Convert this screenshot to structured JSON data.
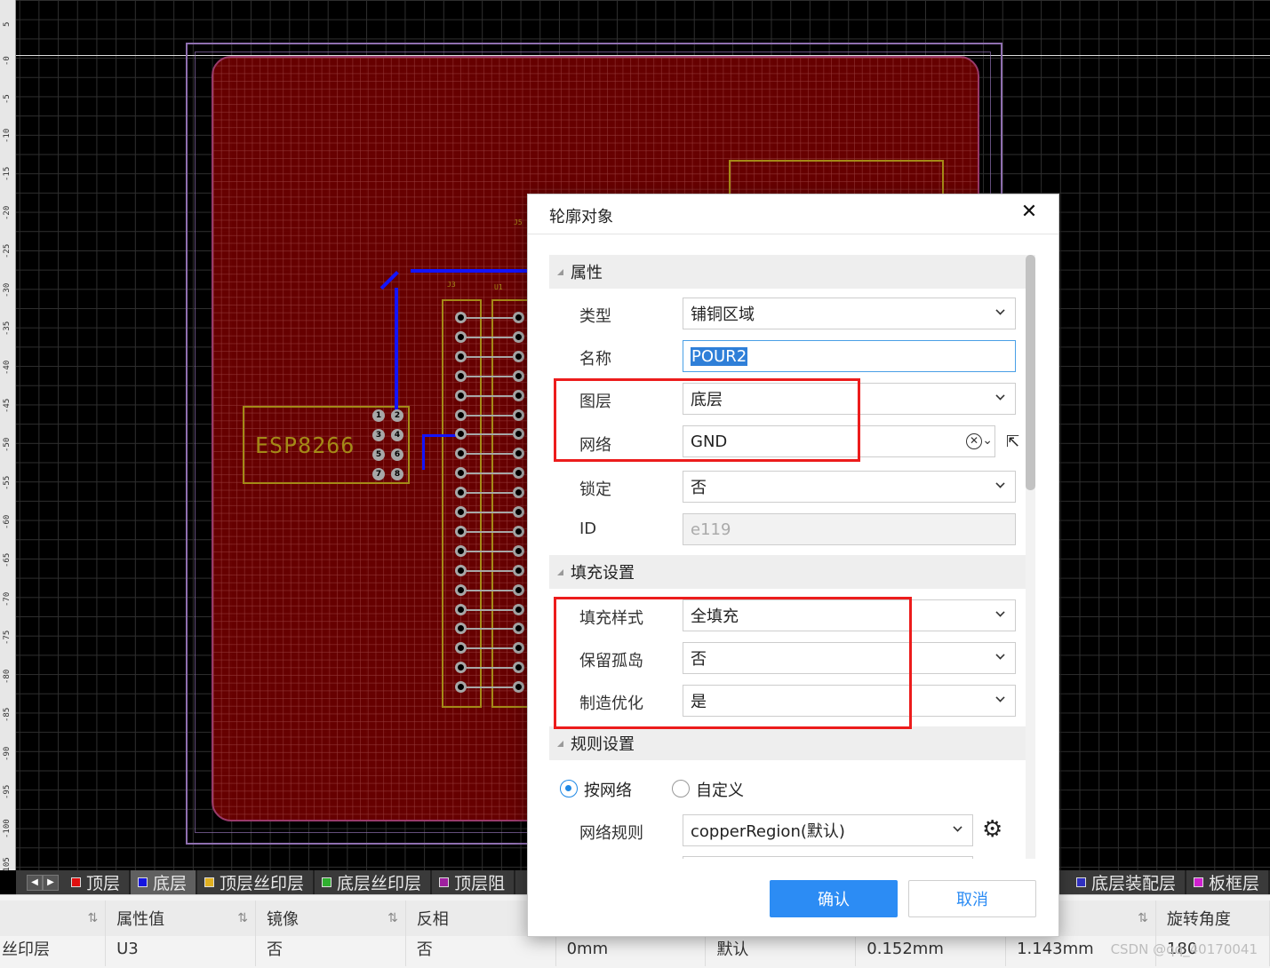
{
  "ruler": {
    "ticks": [
      "5",
      "0",
      "5",
      "10",
      "15",
      "20",
      "25",
      "30",
      "35",
      "40",
      "45",
      "50",
      "55",
      "60",
      "65",
      "70",
      "75",
      "80",
      "85",
      "90",
      "95",
      "100",
      "105"
    ]
  },
  "pcb": {
    "esp_label": "ESP8266",
    "j3_label": "J3",
    "u1_label": "U1",
    "j5_label": "J5",
    "pin_numbers": [
      "1",
      "2",
      "3",
      "4",
      "5",
      "6",
      "7",
      "8"
    ]
  },
  "layer_tabs": [
    {
      "label": "顶层",
      "color": "#e01010"
    },
    {
      "label": "底层",
      "color": "#1515e0",
      "active": true
    },
    {
      "label": "顶层丝印层",
      "color": "#e0b020"
    },
    {
      "label": "底层丝印层",
      "color": "#30b030"
    },
    {
      "label": "顶层阻",
      "color": "#a020a0"
    },
    {
      "label": "底层装配层",
      "color": "#3030c0"
    },
    {
      "label": "板框层",
      "color": "#d020d0"
    }
  ],
  "prop_table": {
    "headers": [
      "",
      "属性值",
      "镜像",
      "反相",
      "",
      "",
      "",
      "",
      "旋转角度"
    ],
    "row": [
      "丝印层",
      "U3",
      "否",
      "否",
      "0mm",
      "默认",
      "0.152mm",
      "1.143mm",
      "180"
    ]
  },
  "dialog": {
    "title": "轮廓对象",
    "sections": {
      "props": "属性",
      "fill": "填充设置",
      "rules": "规则设置"
    },
    "fields": {
      "type_label": "类型",
      "type_value": "铺铜区域",
      "name_label": "名称",
      "name_value": "POUR2",
      "layer_label": "图层",
      "layer_value": "底层",
      "net_label": "网络",
      "net_value": "GND",
      "lock_label": "锁定",
      "lock_value": "否",
      "id_label": "ID",
      "id_value": "e119",
      "fill_style_label": "填充样式",
      "fill_style_value": "全填充",
      "island_label": "保留孤岛",
      "island_value": "否",
      "mfg_label": "制造优化",
      "mfg_value": "是",
      "by_net_label": "按网络",
      "custom_label": "自定义",
      "net_rule_label": "网络规则",
      "net_rule_value": "copperRegion(默认)"
    },
    "ok_label": "确认",
    "cancel_label": "取消"
  },
  "watermark": "CSDN @qq_40170041",
  "colors": {
    "accent": "#2c8cf4",
    "highlight": "#ec1c1c",
    "copper": "#6e0000"
  }
}
